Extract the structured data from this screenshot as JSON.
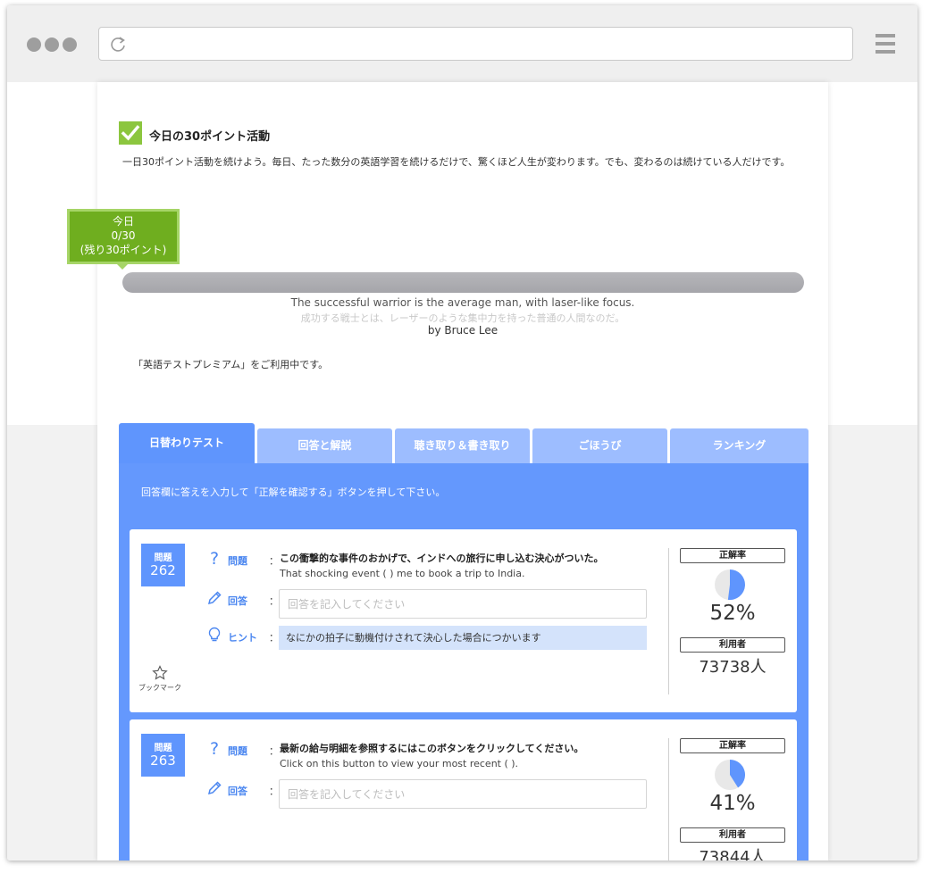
{
  "browser": {
    "url": ""
  },
  "activity": {
    "title": "今日の30ポイント活動",
    "description": "一日30ポイント活動を続けよう。毎日、たった数分の英語学習を続けるだけで、驚くほど人生が変わります。でも、変わるのは続けている人だけです。",
    "badge_day": "今日",
    "badge_score": "0/30",
    "badge_remaining": "(残り30ポイント)",
    "progress_fraction": 0.0
  },
  "quote": {
    "english": "The successful warrior is the average man, with laser-like focus.",
    "japanese": "成功する戦士とは、レーザーのような集中力を持った普通の人間なのだ。",
    "author": "by Bruce Lee"
  },
  "premium_notice": "「英語テストプレミアム」をご利用中です。",
  "tabs": [
    {
      "label": "日替わりテスト",
      "active": true
    },
    {
      "label": "回答と解説",
      "active": false
    },
    {
      "label": "聴き取り＆書き取り",
      "active": false
    },
    {
      "label": "ごほうび",
      "active": false
    },
    {
      "label": "ランキング",
      "active": false
    }
  ],
  "instruction": "回答欄に答えを入力して「正解を確認する」ボタンを押して下さい。",
  "labels": {
    "question_word": "問題",
    "question_label": "問題",
    "answer_label": "回答",
    "hint_label": "ヒント",
    "colon": "：",
    "bookmark": "ブックマーク",
    "accuracy": "正解率",
    "users": "利用者",
    "answer_placeholder": "回答を記入してください"
  },
  "questions": [
    {
      "number": "262",
      "japanese": "この衝撃的な事件のおかげで、インドへの旅行に申し込む決心がついた。",
      "english": "That shocking event ( ) me to book a trip to India.",
      "hint": "なにかの拍子に動機付けされて決心した場合につかいます",
      "accuracy": "52%",
      "accuracy_value": 0.52,
      "users": "73738人"
    },
    {
      "number": "263",
      "japanese": "最新の給与明細を参照するにはこのボタンをクリックしてください。",
      "english": "Click on this button to view your most recent ( ).",
      "accuracy": "41%",
      "accuracy_value": 0.41,
      "users": "73844人"
    }
  ],
  "colors": {
    "accent": "#5f95fd",
    "tab_inactive": "#9dbdff",
    "check": "#8cc63f",
    "badge": "#6fae1f",
    "hint_bg": "#d4e3fb"
  }
}
